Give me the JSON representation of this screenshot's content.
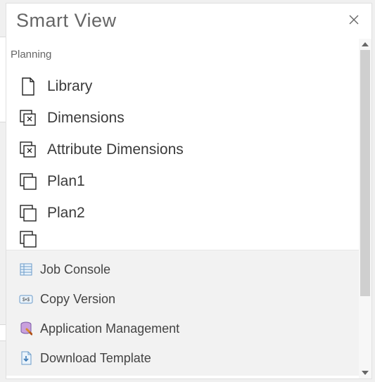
{
  "title": "Smart View",
  "section_label": "Planning",
  "tree": {
    "items": [
      {
        "icon": "document-icon",
        "label": "Library"
      },
      {
        "icon": "dimensions-icon",
        "label": "Dimensions"
      },
      {
        "icon": "dimensions-icon",
        "label": "Attribute Dimensions"
      },
      {
        "icon": "cube-stack-icon",
        "label": "Plan1"
      },
      {
        "icon": "cube-stack-icon",
        "label": "Plan2"
      }
    ]
  },
  "menu": {
    "items": [
      {
        "icon": "job-console-icon",
        "label": "Job Console"
      },
      {
        "icon": "copy-version-icon",
        "label": "Copy Version"
      },
      {
        "icon": "app-mgmt-icon",
        "label": "Application Management"
      },
      {
        "icon": "download-template-icon",
        "label": "Download Template"
      }
    ]
  }
}
